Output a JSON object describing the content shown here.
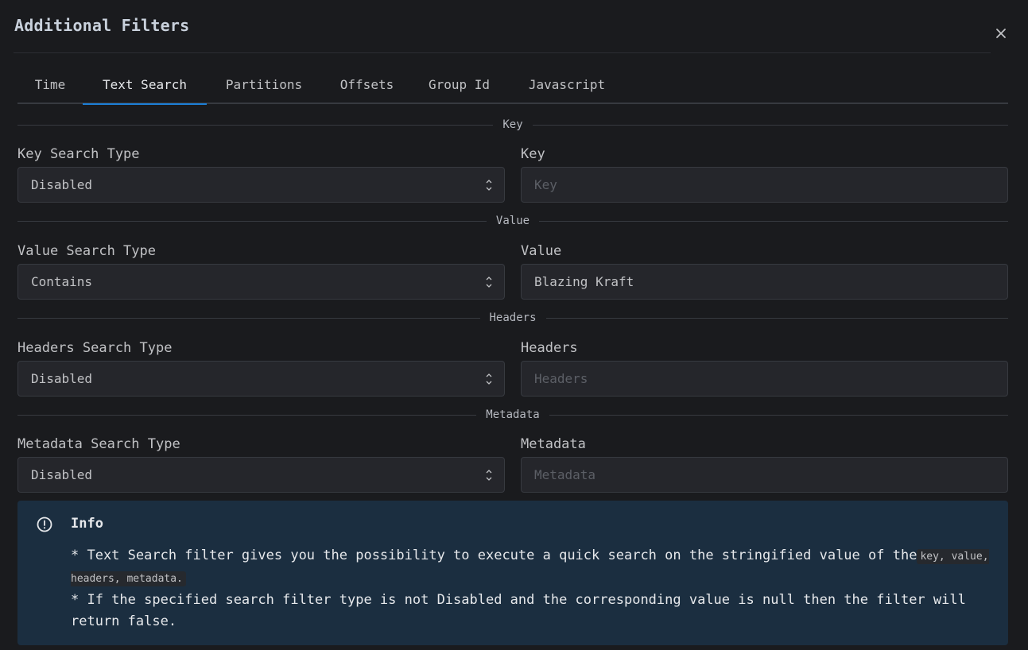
{
  "modal": {
    "title": "Additional Filters",
    "close_icon": "close-icon"
  },
  "tabs": [
    {
      "label": "Time",
      "active": false
    },
    {
      "label": "Text Search",
      "active": true
    },
    {
      "label": "Partitions",
      "active": false
    },
    {
      "label": "Offsets",
      "active": false
    },
    {
      "label": "Group Id",
      "active": false
    },
    {
      "label": "Javascript",
      "active": false
    }
  ],
  "sections": {
    "key": {
      "divider": "Key",
      "type_label": "Key Search Type",
      "type_value": "Disabled",
      "input_label": "Key",
      "input_value": "",
      "input_placeholder": "Key"
    },
    "value": {
      "divider": "Value",
      "type_label": "Value Search Type",
      "type_value": "Contains",
      "input_label": "Value",
      "input_value": "Blazing Kraft",
      "input_placeholder": "Value"
    },
    "headers": {
      "divider": "Headers",
      "type_label": "Headers Search Type",
      "type_value": "Disabled",
      "input_label": "Headers",
      "input_value": "",
      "input_placeholder": "Headers"
    },
    "metadata": {
      "divider": "Metadata",
      "type_label": "Metadata Search Type",
      "type_value": "Disabled",
      "input_label": "Metadata",
      "input_value": "",
      "input_placeholder": "Metadata"
    }
  },
  "info": {
    "icon": "info-circle-icon",
    "title": "Info",
    "line1_text": "* Text Search filter gives you the possibility to execute a quick search on the stringified value of the",
    "line1_code": "key, value, headers, metadata.",
    "line2_text": "* If the specified search filter type is not Disabled and the corresponding value is null then the filter will return false."
  },
  "colors": {
    "accent": "#1c7ed6",
    "background": "#1a1b1e",
    "info_background": "#1b2e40"
  }
}
